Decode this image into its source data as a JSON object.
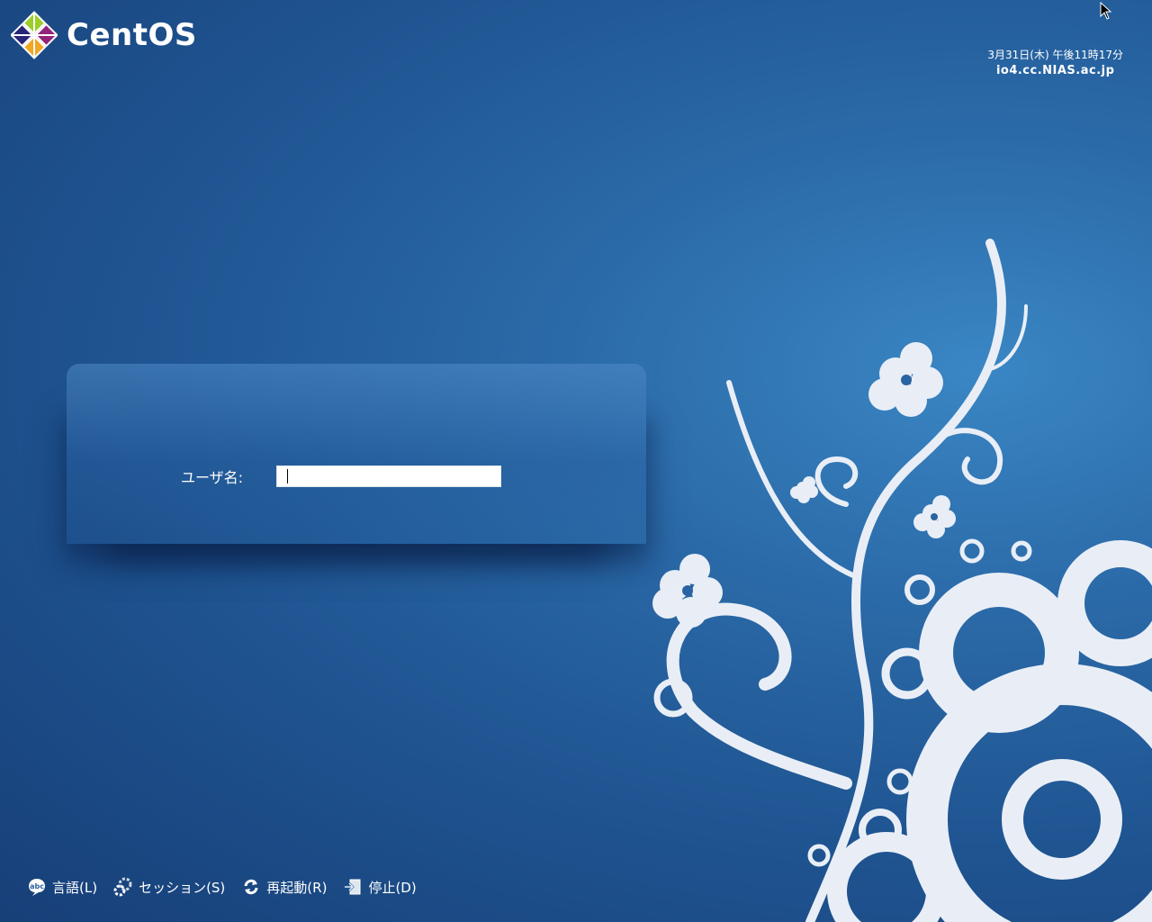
{
  "brand": {
    "name": "CentOS"
  },
  "clock": {
    "datetime": "3月31日(木) 午後11時17分",
    "hostname": "io4.cc.NIAS.ac.jp"
  },
  "login": {
    "username_label": "ユーザ名:",
    "username_value": ""
  },
  "bottom_bar": {
    "items": [
      {
        "label": "言語(L)",
        "icon": "language-icon"
      },
      {
        "label": "セッション(S)",
        "icon": "session-gear-icon"
      },
      {
        "label": "再起動(R)",
        "icon": "restart-icon"
      },
      {
        "label": "停止(D)",
        "icon": "shutdown-icon"
      }
    ]
  },
  "colors": {
    "background": "#2a63a2",
    "decoration": "#e9eef6"
  }
}
